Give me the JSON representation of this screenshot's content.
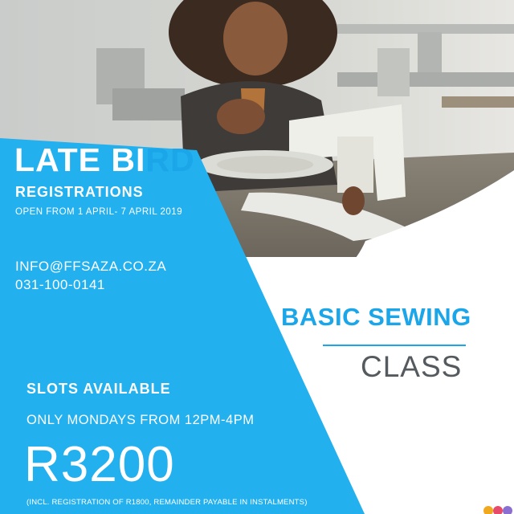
{
  "headline": {
    "part_plain": "LATE BI",
    "part_accent": "RD"
  },
  "subheadline": "REGISTRATIONS",
  "dates": "OPEN FROM  1 APRIL- 7 APRIL 2019",
  "contact": {
    "email": "INFO@FFSAZA.CO.ZA",
    "phone": "031-100-0141"
  },
  "course": {
    "title": "BASIC SEWING",
    "subtitle": "CLASS"
  },
  "slots": "SLOTS AVAILABLE",
  "schedule": "ONLY MONDAYS FROM 12PM-4PM",
  "price": {
    "amount": "R3200",
    "note": "(INCL. REGISTRATION OF R1800, REMAINDER PAYABLE IN INSTALMENTS)"
  },
  "colors": {
    "accent_blue": "#1aa6e8",
    "panel_blue": "#22b0ef",
    "subtitle_gray": "#555a5f",
    "background": "#ffffff"
  },
  "photo_subject": "woman-at-sewing-machine"
}
